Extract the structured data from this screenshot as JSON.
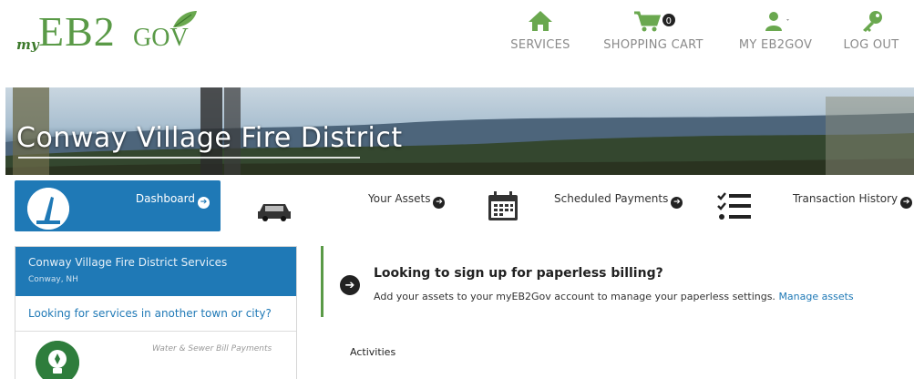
{
  "header": {
    "logo": {
      "my": "my",
      "eb2": "EB2",
      "gov": "GOV"
    },
    "nav": [
      {
        "label": "SERVICES",
        "icon": "home-icon"
      },
      {
        "label": "SHOPPING CART",
        "icon": "shopping-cart-icon",
        "badge": "0"
      },
      {
        "label": "MY EB2GOV",
        "icon": "user-icon"
      },
      {
        "label": "LOG OUT",
        "icon": "key-icon"
      }
    ]
  },
  "banner": {
    "title": "Conway Village Fire District"
  },
  "strip": {
    "dashboard": "Dashboard",
    "assets": "Your Assets",
    "scheduled": "Scheduled Payments",
    "history": "Transaction History"
  },
  "leftpanel": {
    "title": "Conway Village Fire District Services",
    "subtitle": "Conway, NH",
    "search_other": "Looking for services in another town or city?",
    "service_label": "Water & Sewer Bill Payments"
  },
  "notice": {
    "heading": "Looking to sign up for paperless billing?",
    "body": "Add your assets to your myEB2Gov account to manage your paperless settings.",
    "link": "Manage assets"
  },
  "main": {
    "activities_label": "Activities"
  },
  "colors": {
    "brand_green": "#5a9a47",
    "primary_blue": "#1f79b6",
    "icon_green": "#6aa84f"
  }
}
